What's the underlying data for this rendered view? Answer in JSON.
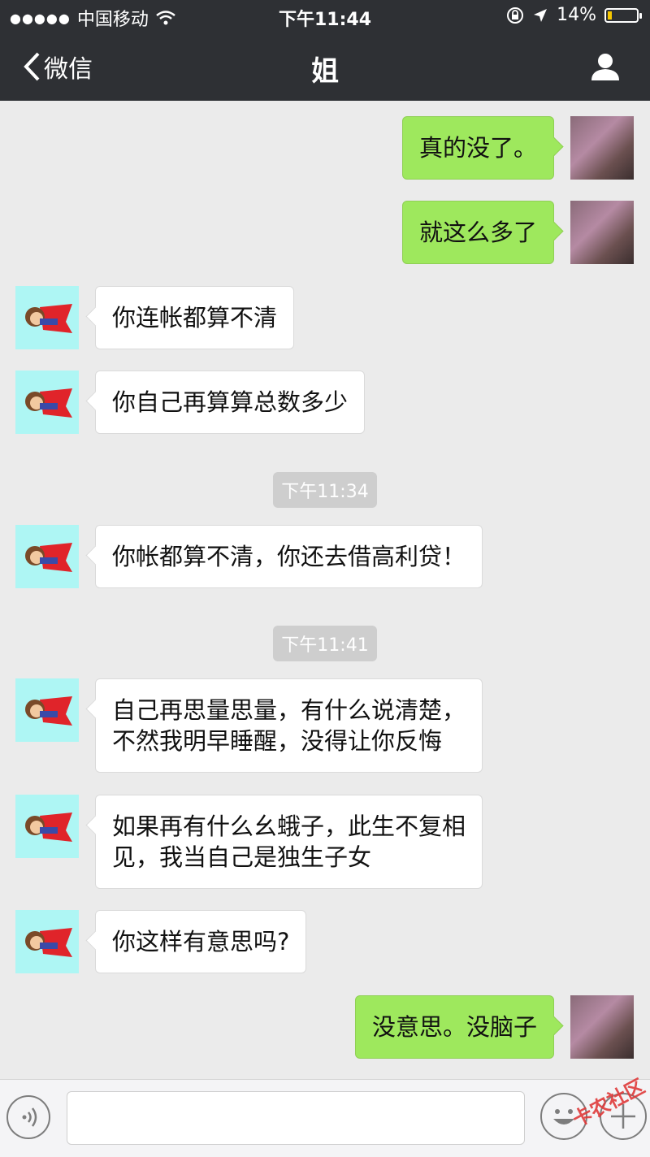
{
  "status_bar": {
    "carrier": "中国移动",
    "time": "下午11:44",
    "battery": "14%",
    "battery_level": 0.14
  },
  "nav": {
    "back_label": "微信",
    "title": "姐"
  },
  "messages": [
    {
      "side": "right",
      "text": "真的没了。"
    },
    {
      "side": "right",
      "text": "就这么多了"
    },
    {
      "side": "left",
      "text": "你连帐都算不清"
    },
    {
      "side": "left",
      "text": "你自己再算算总数多少"
    },
    {
      "side": "time",
      "text": "下午11:34"
    },
    {
      "side": "left",
      "text": "你帐都算不清，你还去借高利贷！"
    },
    {
      "side": "time",
      "text": "下午11:41"
    },
    {
      "side": "left",
      "text": "自己再思量思量，有什么说清楚，\n不然我明早睡醒，没得让你反悔"
    },
    {
      "side": "left",
      "text": "如果再有什么幺蛾子，此生不复相\n见，我当自己是独生子女"
    },
    {
      "side": "left",
      "text": "你这样有意思吗?"
    },
    {
      "side": "right",
      "text": "没意思。没脑子"
    }
  ],
  "watermark": "卡农社区",
  "colors": {
    "nav_bg": "#2e3034",
    "sent_bubble": "#9ee85d",
    "received_bubble": "#ffffff",
    "chat_bg": "#ebebeb"
  }
}
